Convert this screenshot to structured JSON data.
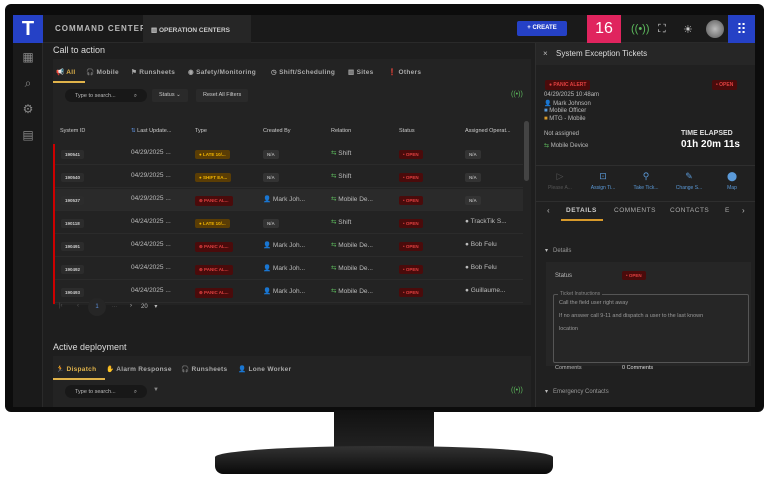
{
  "colors": {
    "brand": "#2541c6",
    "alert_counter": "#e0245e",
    "accent": "#e0b34a",
    "open": "#e04040",
    "late": "#f0b400"
  },
  "sidebar": {
    "logo": "T",
    "icons": [
      "dashboard-icon",
      "search-icon",
      "gear-icon",
      "map-icon"
    ]
  },
  "header": {
    "title": "COMMAND CENTER",
    "operation_centers": "OPERATION CENTERS",
    "create": "+ CREATE",
    "alert_count": "16"
  },
  "cta": {
    "title": "Call to action",
    "tabs": [
      "All",
      "Mobile",
      "Runsheets",
      "Safety/Monitoring",
      "Shift/Scheduling",
      "Sites",
      "Others"
    ],
    "search_placeholder": "Type to search...",
    "status_filter": "Status",
    "reset": "Reset All Filters",
    "columns": [
      "System ID",
      "Last Update...",
      "Type",
      "Created By",
      "Relation",
      "Status",
      "Assigned Operat..."
    ],
    "rows": [
      {
        "id": "190541",
        "date": "04/29/2025 ...",
        "type": "LATE 10/...",
        "kind": "late",
        "created": "N/A",
        "relation": "Shift",
        "status": "OPEN",
        "assigned": "N/A"
      },
      {
        "id": "190540",
        "date": "04/29/2025 ...",
        "type": "SHIFT EA...",
        "kind": "late",
        "created": "N/A",
        "relation": "Shift",
        "status": "OPEN",
        "assigned": "N/A"
      },
      {
        "id": "190537",
        "date": "04/29/2025 ...",
        "type": "PANIC AL...",
        "kind": "panic",
        "created": "Mark Joh...",
        "relation": "Mobile De...",
        "status": "OPEN",
        "assigned": "N/A"
      },
      {
        "id": "190118",
        "date": "04/24/2025 ...",
        "type": "LATE 10/...",
        "kind": "late",
        "created": "N/A",
        "relation": "Shift",
        "status": "OPEN",
        "assigned": "TrackTik S..."
      },
      {
        "id": "190491",
        "date": "04/24/2025 ...",
        "type": "PANIC AL...",
        "kind": "panic",
        "created": "Mark Joh...",
        "relation": "Mobile De...",
        "status": "OPEN",
        "assigned": "Bob Felu"
      },
      {
        "id": "190492",
        "date": "04/24/2025 ...",
        "type": "PANIC AL...",
        "kind": "panic",
        "created": "Mark Joh...",
        "relation": "Mobile De...",
        "status": "OPEN",
        "assigned": "Bob Felu"
      },
      {
        "id": "190493",
        "date": "04/24/2025 ...",
        "type": "PANIC AL...",
        "kind": "panic",
        "created": "Mark Joh...",
        "relation": "Mobile De...",
        "status": "OPEN",
        "assigned": "Guillaume..."
      }
    ],
    "pagination": {
      "page": "1",
      "ellipsis": "...",
      "page_size": "20"
    }
  },
  "deployment": {
    "title": "Active deployment",
    "tabs": [
      "Dispatch",
      "Alarm Response",
      "Runsheets",
      "Lone Worker"
    ],
    "search_placeholder": "Type to search..."
  },
  "panel": {
    "title": "System Exception Tickets",
    "type": "PANIC ALERT",
    "status": "OPEN",
    "datetime": "04/29/2025 10:48am",
    "user": "Mark Johnson",
    "role": "Mobile Officer",
    "site": "MTG - Mobile",
    "assignment": "Not assigned",
    "relation": "Mobile Device",
    "elapsed_label": "TIME ELAPSED",
    "elapsed": "01h 20m 11s",
    "actions": [
      "Please A...",
      "Assign Ti...",
      "Take Tick...",
      "Change S...",
      "Map"
    ],
    "tabs": [
      "DETAILS",
      "COMMENTS",
      "CONTACTS",
      "E"
    ],
    "details_header": "Details",
    "status_label": "Status",
    "instructions_label": "Ticket Instructions",
    "instructions": [
      "Call the field user right away",
      "If no answer call 9-11 and dispatch a user to the last known",
      "location"
    ],
    "comments_label": "Comments",
    "comments_value": "0 Comments",
    "emergency_header": "Emergency Contacts"
  }
}
